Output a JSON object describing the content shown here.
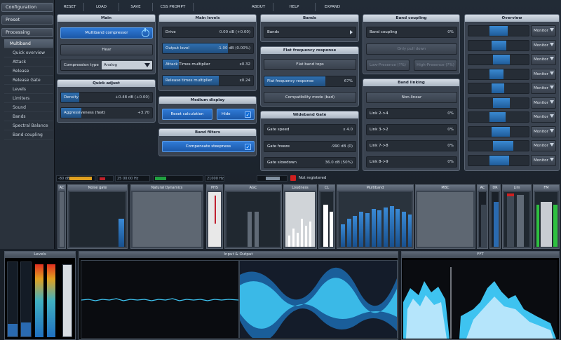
{
  "sidebar": {
    "sections": [
      "Configuration",
      "Preset",
      "Processing"
    ],
    "items": [
      "Multiband",
      "Quick overview",
      "Attack",
      "Release",
      "Release Gate",
      "Levels",
      "Limiters",
      "Sound",
      "Bands",
      "Spectral Balance",
      "Band coupling"
    ],
    "selected": "Multiband"
  },
  "topbar": [
    "RESET",
    "LOAD",
    "SAVE",
    "CSS PROMPT",
    "ABOUT",
    "HELP",
    "EXPAND"
  ],
  "main": {
    "title": "Main",
    "multiband_button": "Multiband compressor",
    "hear_button": "Hear",
    "comp_type_label": "Compression type",
    "comp_type_value": "Analog"
  },
  "quick_adjust": {
    "title": "Quick adjust",
    "density_label": "Density",
    "density_value": "+0.48 dB (+0.00)",
    "agg_label": "Aggressiveness (fast)",
    "agg_value": "+3.70"
  },
  "main_levels": {
    "title": "Main levels",
    "rows": [
      {
        "label": "Drive",
        "value": "0.00 dB (+0.00)",
        "fill": 0.0
      },
      {
        "label": "Output level",
        "value": "-1.00 dB (0.00%)",
        "fill": 0.72
      },
      {
        "label": "Attack Times multiplier",
        "value": "x0.32",
        "fill": 0.18
      },
      {
        "label": "Release times multiplier",
        "value": "x0.24",
        "fill": 0.62
      }
    ]
  },
  "medium_displays": {
    "title": "Medium display",
    "reset_button": "Reset calculation",
    "hide_button": "Hide"
  },
  "band_filters": {
    "title": "Band filters",
    "comp_button": "Compensate steepness"
  },
  "bands": {
    "title": "Bands",
    "value": "Bands"
  },
  "flat": {
    "title": "Flat frequency response",
    "flat_button": "Flat band tops",
    "freq_label": "Flat frequency response",
    "freq_value": "67%",
    "compat_button": "Compatibility mode (bad)"
  },
  "wideband_gate": {
    "title": "Wideband Gate",
    "rows": [
      {
        "label": "Gate speed",
        "value": "x 4.0",
        "fill": 0.0
      },
      {
        "label": "Gate freeze",
        "value": "-990 dB (0)",
        "fill": 0.0
      },
      {
        "label": "Gate slowdown",
        "value": "36.0 dB (50%)",
        "fill": 0.0
      }
    ]
  },
  "band_coupling": {
    "title": "Band coupling",
    "coupling_label": "Band coupling",
    "coupling_value": "0%",
    "pull_button": "Only pull down",
    "low_button": "Low-Presence (?%)",
    "high_button": "High-Presence (?%)"
  },
  "band_linking": {
    "title": "Band linking",
    "nonlinear_button": "Non-linear",
    "rows": [
      {
        "label": "Link 2->4",
        "value": "0%"
      },
      {
        "label": "Link 3->2",
        "value": "0%"
      },
      {
        "label": "Link 7->8",
        "value": "0%"
      },
      {
        "label": "Link 8->9",
        "value": "0%"
      }
    ]
  },
  "overview": {
    "title": "Overview",
    "monitor_label": "Monitor",
    "levels": [
      0.55,
      0.45,
      0.5,
      0.42,
      0.38,
      0.5,
      0.48,
      0.55,
      0.6,
      0.6
    ]
  },
  "meters": {
    "left": "-80 dB",
    "freq": "25 00:00 Hz",
    "ratio": "21000 Hz",
    "status": "Not registered"
  },
  "modules": [
    "AC",
    "Noise gate",
    "Natural Dynamics",
    "PHS",
    "AGC",
    "Loudness",
    "CL",
    "Multiband",
    "MBC",
    "AC",
    "DR",
    "Lim",
    "FM"
  ],
  "lower": {
    "levels_title": "Levels",
    "io_title": "Input & Output",
    "fft_title": "FFT"
  },
  "colors": {
    "accent": "#2f7ad6",
    "panel": "#3a4350",
    "waveform": "#3ec3f0"
  }
}
